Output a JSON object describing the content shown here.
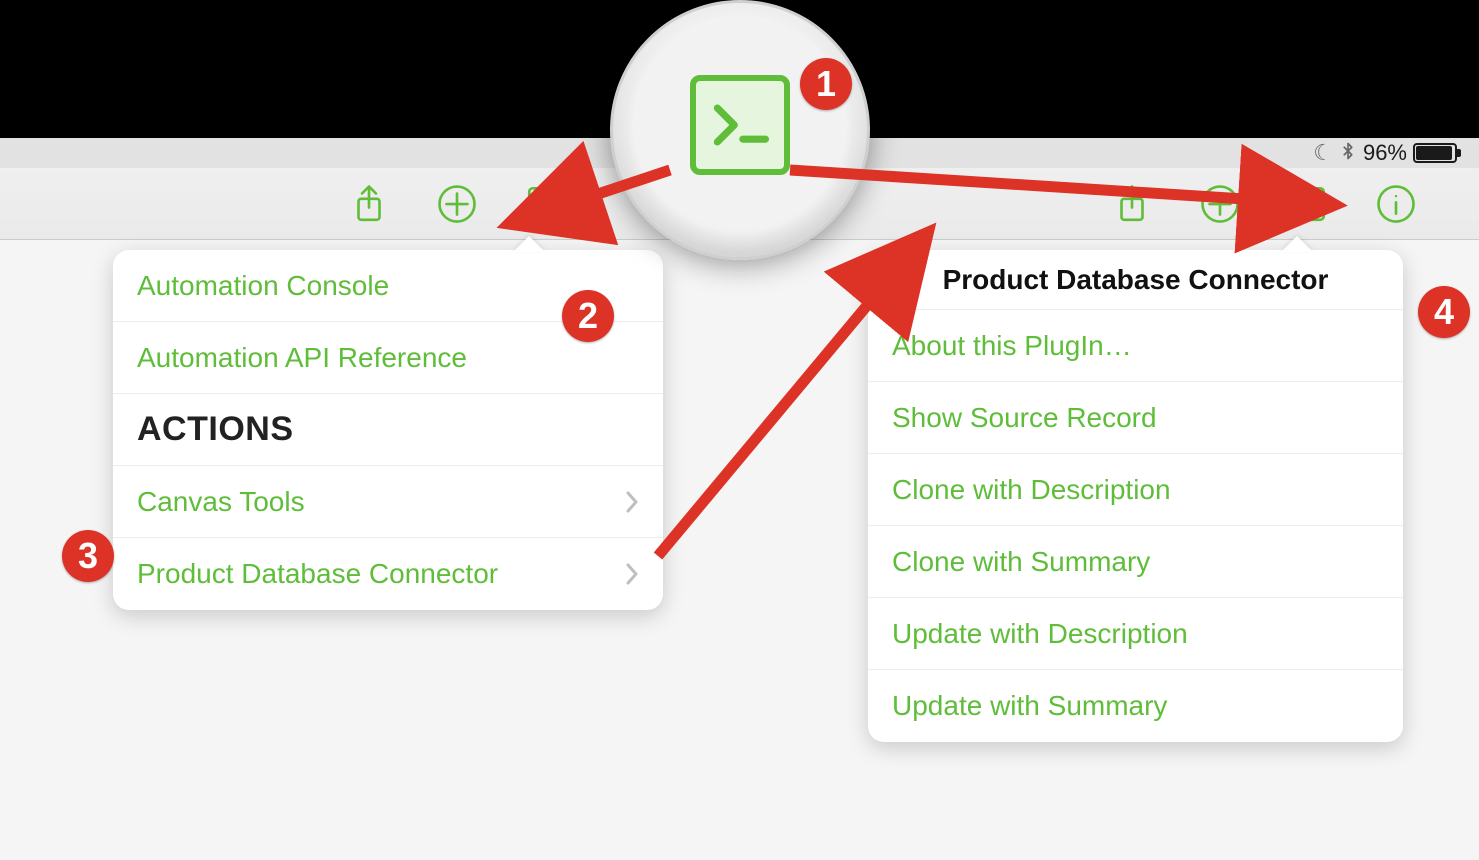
{
  "status": {
    "battery_text": "96%",
    "battery_fill_pct": 96,
    "moon_icon": "☾",
    "bt_icon_center": "bluetooth-icon",
    "bt_icon_right": "bluetooth-icon"
  },
  "toolbar": {
    "share_icon": "share-icon",
    "new_icon": "plus-circle-icon",
    "console_icon": "terminal-icon",
    "info_icon": "info-icon"
  },
  "left_popover": {
    "items": [
      {
        "label": "Automation Console",
        "chevron": false
      },
      {
        "label": "Automation API Reference",
        "chevron": false
      }
    ],
    "section_header": "ACTIONS",
    "actions": [
      {
        "label": "Canvas Tools",
        "chevron": true
      },
      {
        "label": "Product Database Connector",
        "chevron": true
      }
    ]
  },
  "right_popover": {
    "title": "Product Database Connector",
    "items": [
      {
        "label": "About this PlugIn…"
      },
      {
        "label": "Show Source Record"
      },
      {
        "label": "Clone with Description"
      },
      {
        "label": "Clone with Summary"
      },
      {
        "label": "Update with Description"
      },
      {
        "label": "Update with Summary"
      }
    ]
  },
  "callouts": {
    "c1": "1",
    "c2": "2",
    "c3": "3",
    "c4": "4"
  }
}
